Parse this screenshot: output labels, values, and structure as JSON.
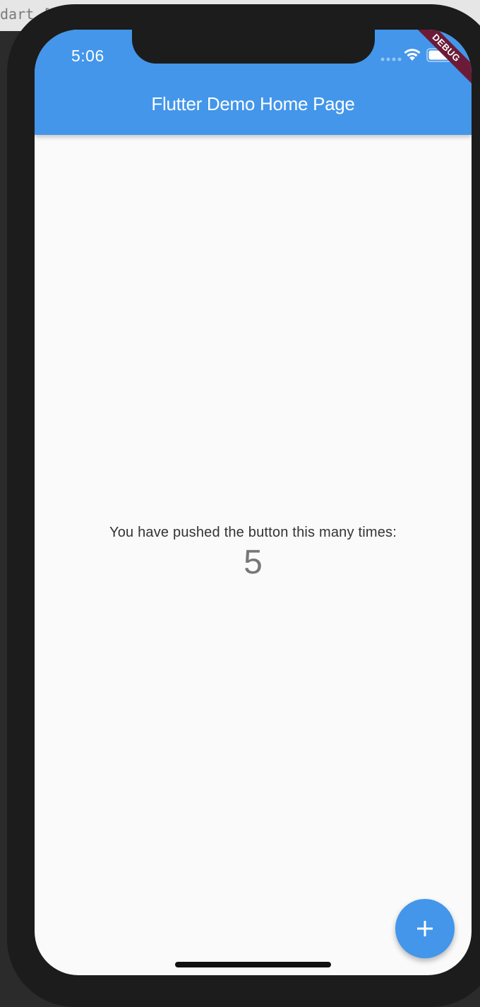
{
  "background_window": {
    "tab_text": "dart ["
  },
  "status_bar": {
    "time": "5:06"
  },
  "debug_banner": {
    "label": "DEBUG"
  },
  "app_bar": {
    "title": "Flutter Demo Home Page"
  },
  "main": {
    "caption": "You have pushed the button this many times:",
    "counter": "5"
  },
  "fab": {
    "icon": "plus-icon"
  },
  "colors": {
    "primary": "#4396ea",
    "debug_ribbon": "#6b1b37",
    "background": "#fafafa",
    "device_frame": "#1c1c1c"
  }
}
